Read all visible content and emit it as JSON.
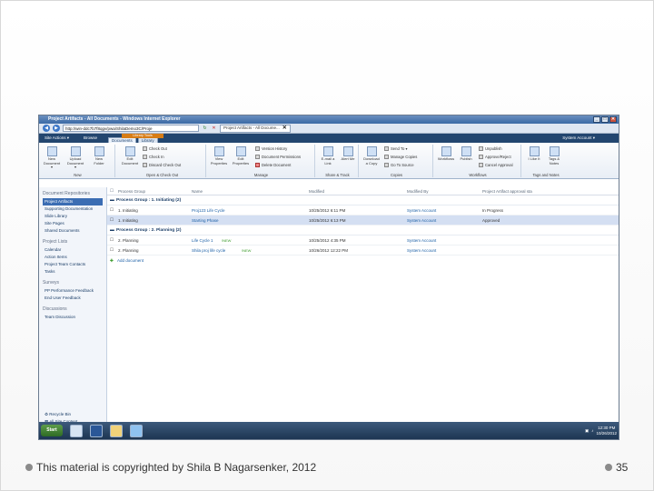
{
  "window": {
    "title": "Project Artifacts - All Documents - Windows Internet Explorer"
  },
  "address": {
    "url": "http://win-ddc7b7f8qgv/pwa/ShilaDemo3C/Proje",
    "tab_label": "Project Artifacts - All Docume..."
  },
  "sp": {
    "site_actions": "Site Actions ▾",
    "browse": "Browse",
    "tools_label": "Library Tools",
    "ribbon_tabs": [
      "Documents",
      "Library"
    ],
    "user": "System Account ▾"
  },
  "ribbon": {
    "groups": [
      "New",
      "Open & Check Out",
      "Manage",
      "Share & Track",
      "Copies",
      "Workflows",
      "Tags and Notes"
    ],
    "new_doc": "New Document ▾",
    "upload": "Upload Document ▾",
    "new_folder": "New Folder",
    "edit_doc": "Edit Document",
    "check_out": "Check Out",
    "check_in": "Check In",
    "discard": "Discard Check Out",
    "view_props": "View Properties",
    "edit_props": "Edit Properties",
    "version_history": "Version History",
    "doc_permissions": "Document Permissions",
    "delete_doc": "Delete Document",
    "email_link": "E-mail a Link",
    "alert_me": "Alert Me",
    "download_copy": "Download a Copy",
    "send_to": "Send To ▾",
    "manage_copies": "Manage Copies",
    "go_to_source": "Go To Source",
    "workflows": "Workflows",
    "publish": "Publish",
    "unpublish": "Unpublish",
    "approve_reject": "Approve/Reject",
    "cancel_approval": "Cancel Approval",
    "i_like_it": "I Like It",
    "tags_notes": "Tags & Notes"
  },
  "quicklaunch": {
    "libraries_heading": "Document Repositories",
    "items": [
      "Project Artifacts",
      "Supporting Documentation",
      "Slide Library",
      "Site Pages",
      "Shared Documents"
    ],
    "lists_heading": "Project Lists",
    "list_items": [
      "Calendar",
      "Action Items",
      "Project Team Contacts",
      "Tasks"
    ],
    "surveys_heading": "Surveys",
    "survey_items": [
      "PP Performance Feedback",
      "End User Feedback"
    ],
    "discussions_heading": "Discussions",
    "discussion_items": [
      "Team Discussion"
    ],
    "recycle": "Recycle Bin",
    "all_content": "All Site Content"
  },
  "table": {
    "headers": [
      "Process Group",
      "Name",
      "Modified",
      "Modified By",
      "Project Artifact approval sta"
    ],
    "groups": [
      {
        "label": "Process Group : 1. Initiating (2)",
        "rows": [
          {
            "group": "1. Initiating",
            "name": "Proj123 Life Cycle",
            "modified": "10/25/2012 6:11 PM",
            "by": "System Account",
            "status": "In Progress",
            "hl": false
          },
          {
            "group": "1. Initiating",
            "name": "Starting Phase",
            "modified": "10/25/2012 6:13 PM",
            "by": "System Account",
            "status": "Approved",
            "hl": true
          }
        ]
      },
      {
        "label": "Process Group : 2. Planning (2)",
        "rows": [
          {
            "group": "2. Planning",
            "name": "Life Cycle 1",
            "new": "!NEW",
            "modified": "10/25/2012 4:35 PM",
            "by": "System Account",
            "status": "",
            "hl": false
          },
          {
            "group": "2. Planning",
            "name": "Shila proj life cycle",
            "new": "!NEW",
            "modified": "10/26/2012 12:22 PM",
            "by": "System Account",
            "status": "",
            "hl": false
          }
        ]
      }
    ],
    "add_document": "Add document"
  },
  "taskbar": {
    "start": "Start",
    "time": "12:30 PM",
    "date": "10/26/2012"
  },
  "footer": {
    "copyright": "This material is copyrighted by Shila B Nagarsenker, 2012",
    "page": "35"
  }
}
